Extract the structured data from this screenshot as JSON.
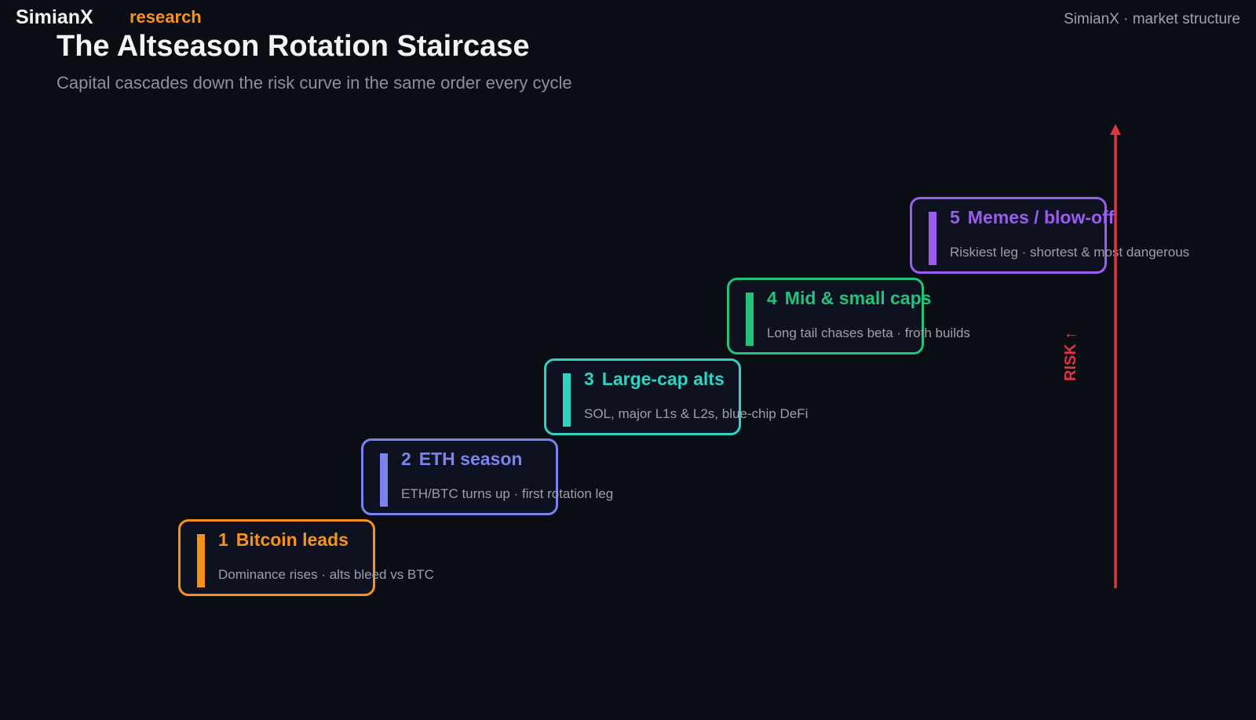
{
  "header": {
    "brand": "SimianX",
    "brand_tag": "research",
    "source": "SimianX · market structure"
  },
  "title": "The Altseason Rotation Staircase",
  "subtitle": "Capital cascades down the risk curve in the same order every cycle",
  "steps": [
    {
      "num": "1",
      "name": "Bitcoin leads",
      "desc": "Dominance rises · alts bleed vs BTC",
      "color": "#f7931a"
    },
    {
      "num": "2",
      "name": "ETH season",
      "desc": "ETH/BTC turns up · first rotation leg",
      "color": "#7b83f0"
    },
    {
      "num": "3",
      "name": "Large-cap alts",
      "desc": "SOL, major L1s & L2s, blue-chip DeFi",
      "color": "#2dd4bf"
    },
    {
      "num": "4",
      "name": "Mid & small caps",
      "desc": "Long tail chases beta · froth builds",
      "color": "#22c37a"
    },
    {
      "num": "5",
      "name": "Memes / blow-off",
      "desc": "Riskiest leg · shortest & most dangerous",
      "color": "#9b5cf0"
    }
  ],
  "axis": {
    "label": "RISK ↑",
    "color": "#e0343f"
  }
}
